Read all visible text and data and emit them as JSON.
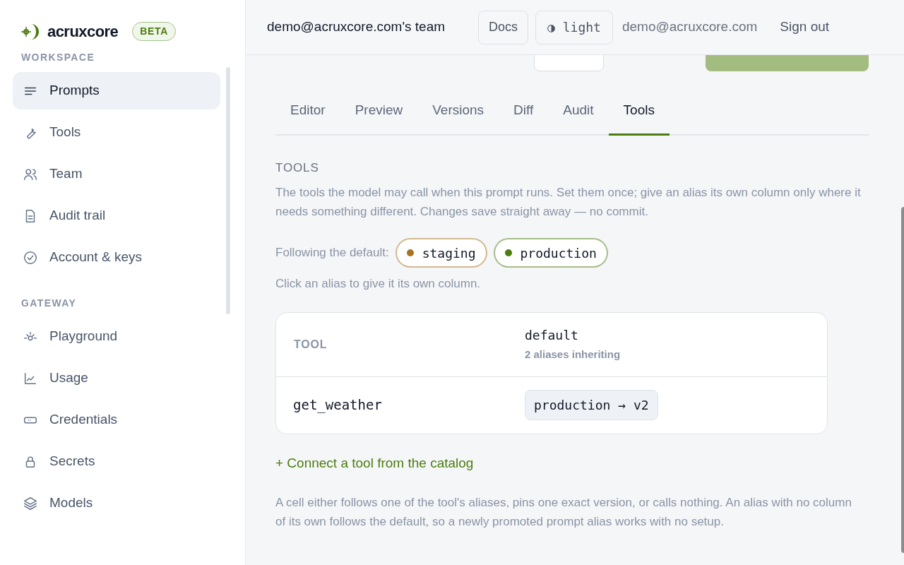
{
  "brand": {
    "name": "acruxcore",
    "badge": "BETA"
  },
  "sidebar": {
    "sections": [
      {
        "title": "WORKSPACE",
        "items": [
          {
            "label": "Prompts",
            "selected": true
          },
          {
            "label": "Tools",
            "selected": false
          },
          {
            "label": "Team",
            "selected": false
          },
          {
            "label": "Audit trail",
            "selected": false
          },
          {
            "label": "Account & keys",
            "selected": false
          }
        ]
      },
      {
        "title": "GATEWAY",
        "items": [
          {
            "label": "Playground",
            "selected": false
          },
          {
            "label": "Usage",
            "selected": false
          },
          {
            "label": "Credentials",
            "selected": false
          },
          {
            "label": "Secrets",
            "selected": false
          },
          {
            "label": "Models",
            "selected": false
          }
        ]
      }
    ]
  },
  "header": {
    "team": "demo@acruxcore.com's team",
    "docs": "Docs",
    "theme": "◑ light",
    "email": "demo@acruxcore.com",
    "sign_out": "Sign out"
  },
  "tabs": [
    {
      "label": "Editor",
      "selected": false
    },
    {
      "label": "Preview",
      "selected": false
    },
    {
      "label": "Versions",
      "selected": false
    },
    {
      "label": "Diff",
      "selected": false
    },
    {
      "label": "Audit",
      "selected": false
    },
    {
      "label": "Tools",
      "selected": true
    }
  ],
  "section": {
    "title": "TOOLS",
    "description": "The tools the model may call when this prompt runs. Set them once; give an alias its own column only where it needs something different. Changes save straight away — no commit.",
    "following_label": "Following the default:",
    "aliases": [
      {
        "name": "staging",
        "color": "#a8731f"
      },
      {
        "name": "production",
        "color": "#4d7c0f"
      }
    ],
    "hint": "Click an alias to give it its own column."
  },
  "table": {
    "columns": [
      {
        "label": "TOOL"
      },
      {
        "label": "default",
        "sub": "2 aliases inheriting"
      }
    ],
    "rows": [
      {
        "tool": "get_weather",
        "value": "production → v2"
      }
    ]
  },
  "connect_link": "+ Connect a tool from the catalog",
  "footnote": "A cell either follows one of the tool's aliases, pins one exact version, or calls nothing. An alias with no column of its own follows the default, so a newly promoted prompt alias works with no setup."
}
